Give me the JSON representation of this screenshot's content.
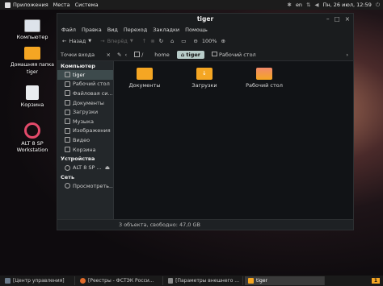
{
  "topbar": {
    "menu_apps": "Приложения",
    "menu_places": "Места",
    "menu_system": "Система",
    "lang": "en",
    "datetime": "Пн, 26 июл, 12:59"
  },
  "desktop_icons": [
    {
      "label": "Компьютер"
    },
    {
      "label": "Домашняя папка tiger"
    },
    {
      "label": "Корзина"
    },
    {
      "label": "ALT 8 SP Workstation"
    }
  ],
  "window": {
    "title": "tiger",
    "menu": [
      "Файл",
      "Правка",
      "Вид",
      "Переход",
      "Закладки",
      "Помощь"
    ],
    "toolbar": {
      "back": "Назад",
      "forward": "Вперёд",
      "zoom": "100%"
    },
    "location": {
      "mode": "Точки входа",
      "root": "/",
      "crumbs": [
        "home",
        "tiger",
        "Рабочий стол"
      ]
    },
    "sidebar": {
      "computer_header": "Компьютер",
      "computer_items": [
        "tiger",
        "Рабочий стол",
        "Файловая си...",
        "Документы",
        "Загрузки",
        "Музыка",
        "Изображения",
        "Видео",
        "Корзина"
      ],
      "devices_header": "Устройства",
      "device_items": [
        "ALT 8 SP ..."
      ],
      "network_header": "Сеть",
      "network_items": [
        "Просмотреть..."
      ]
    },
    "folders": [
      "Документы",
      "Загрузки",
      "Рабочий стол"
    ],
    "status": "3 объекта, свободно: 47,0 GB"
  },
  "taskbar": {
    "items": [
      "[Центр управления]",
      "[Реестры - ФСТЭК Росси...",
      "[Параметры внешнего ...",
      "tiger"
    ],
    "workspace": "1"
  },
  "colors": {
    "accent": "#b8ccc9",
    "folder": "#f5a623",
    "selection": "#3d4a4c"
  }
}
